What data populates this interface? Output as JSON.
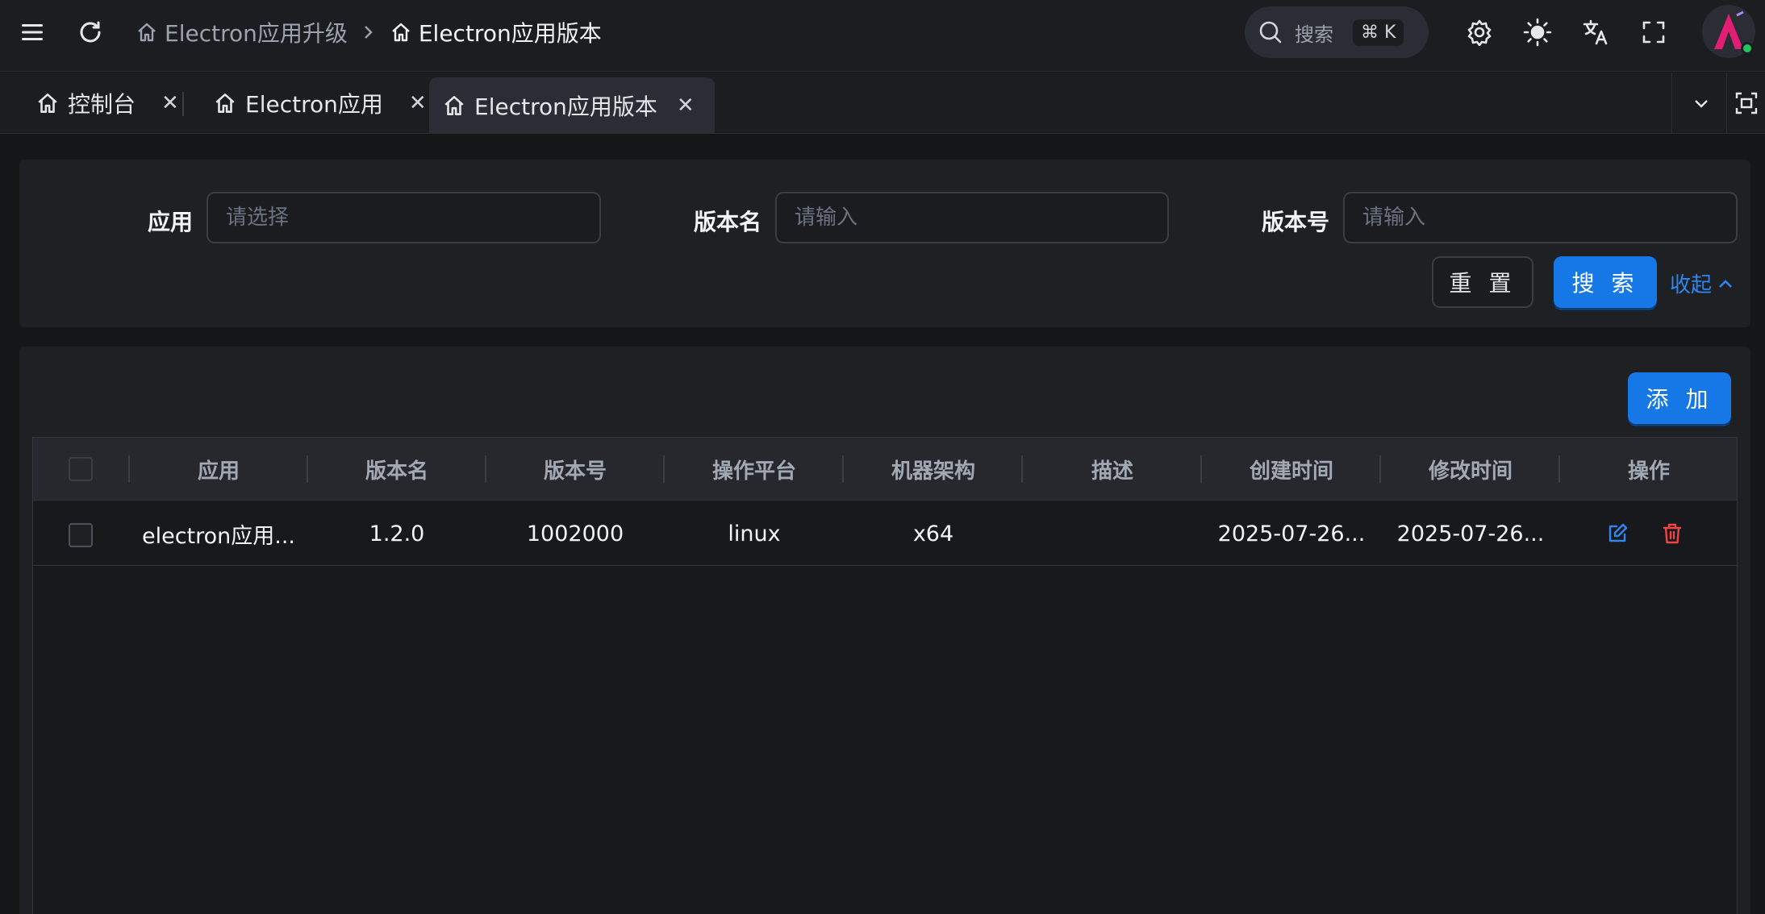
{
  "breadcrumb": {
    "items": [
      {
        "label": "Electron应用升级"
      },
      {
        "label": "Electron应用版本"
      }
    ]
  },
  "header": {
    "search_label": "搜索",
    "search_shortcut": "⌘ K"
  },
  "tabs": [
    {
      "label": "控制台"
    },
    {
      "label": "Electron应用"
    },
    {
      "label": "Electron应用版本",
      "active": true
    }
  ],
  "filter": {
    "app_label": "应用",
    "app_placeholder": "请选择",
    "version_name_label": "版本名",
    "version_name_placeholder": "请输入",
    "version_code_label": "版本号",
    "version_code_placeholder": "请输入",
    "reset_label": "重 置",
    "search_label": "搜 索",
    "collapse_label": "收起"
  },
  "toolbar": {
    "add_label": "添 加"
  },
  "table": {
    "columns": [
      "应用",
      "版本名",
      "版本号",
      "操作平台",
      "机器架构",
      "描述",
      "创建时间",
      "修改时间",
      "操作"
    ],
    "rows": [
      {
        "app": "electron应用...",
        "version_name": "1.2.0",
        "version_code": "1002000",
        "platform": "linux",
        "arch": "x64",
        "description": "",
        "created": "2025-07-26...",
        "modified": "2025-07-26..."
      }
    ]
  },
  "colors": {
    "primary": "#1677e6",
    "danger": "#ef4444",
    "link": "#2f86f0",
    "online": "#22c55e"
  }
}
